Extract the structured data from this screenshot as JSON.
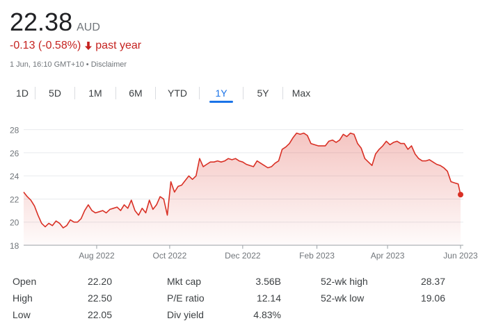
{
  "quote": {
    "price": "22.38",
    "currency": "AUD",
    "change": "-0.13 (-0.58%)",
    "period": "past year",
    "timestamp": "1 Jun, 16:10 GMT+10",
    "separator": "•",
    "disclaimer": "Disclaimer",
    "down_color": "#c5221f"
  },
  "tabs": [
    {
      "label": "1D",
      "active": false
    },
    {
      "label": "5D",
      "active": false
    },
    {
      "label": "1M",
      "active": false
    },
    {
      "label": "6M",
      "active": false
    },
    {
      "label": "YTD",
      "active": false
    },
    {
      "label": "1Y",
      "active": true
    },
    {
      "label": "5Y",
      "active": false
    },
    {
      "label": "Max",
      "active": false
    }
  ],
  "chart_data": {
    "type": "area",
    "title": "",
    "xlabel": "",
    "ylabel": "",
    "ylim": [
      18,
      29
    ],
    "yticks": [
      "18",
      "20",
      "22",
      "24",
      "26",
      "28"
    ],
    "xlim": [
      "2022-06-01",
      "2023-06-01"
    ],
    "xticks": [
      {
        "label": "Aug 2022",
        "date": "2022-08-01"
      },
      {
        "label": "Oct 2022",
        "date": "2022-10-01"
      },
      {
        "label": "Dec 2022",
        "date": "2022-12-01"
      },
      {
        "label": "Feb 2023",
        "date": "2023-02-01"
      },
      {
        "label": "Apr 2023",
        "date": "2023-04-01"
      },
      {
        "label": "Jun 2023",
        "date": "2023-06-01"
      }
    ],
    "line_color": "#d93025",
    "grid": true,
    "x": [
      "2022-06-01",
      "2022-06-04",
      "2022-06-07",
      "2022-06-10",
      "2022-06-13",
      "2022-06-16",
      "2022-06-19",
      "2022-06-22",
      "2022-06-25",
      "2022-06-28",
      "2022-07-01",
      "2022-07-04",
      "2022-07-07",
      "2022-07-10",
      "2022-07-13",
      "2022-07-16",
      "2022-07-19",
      "2022-07-22",
      "2022-07-25",
      "2022-07-28",
      "2022-07-31",
      "2022-08-03",
      "2022-08-06",
      "2022-08-09",
      "2022-08-12",
      "2022-08-15",
      "2022-08-18",
      "2022-08-21",
      "2022-08-24",
      "2022-08-27",
      "2022-08-30",
      "2022-09-02",
      "2022-09-05",
      "2022-09-08",
      "2022-09-11",
      "2022-09-14",
      "2022-09-17",
      "2022-09-20",
      "2022-09-23",
      "2022-09-26",
      "2022-09-29",
      "2022-10-02",
      "2022-10-05",
      "2022-10-08",
      "2022-10-11",
      "2022-10-14",
      "2022-10-17",
      "2022-10-20",
      "2022-10-23",
      "2022-10-26",
      "2022-10-29",
      "2022-11-01",
      "2022-11-04",
      "2022-11-07",
      "2022-11-10",
      "2022-11-13",
      "2022-11-16",
      "2022-11-19",
      "2022-11-22",
      "2022-11-25",
      "2022-11-28",
      "2022-12-01",
      "2022-12-04",
      "2022-12-07",
      "2022-12-10",
      "2022-12-13",
      "2022-12-16",
      "2022-12-19",
      "2022-12-22",
      "2022-12-25",
      "2022-12-28",
      "2022-12-31",
      "2023-01-03",
      "2023-01-06",
      "2023-01-09",
      "2023-01-12",
      "2023-01-15",
      "2023-01-18",
      "2023-01-21",
      "2023-01-24",
      "2023-01-27",
      "2023-01-30",
      "2023-02-02",
      "2023-02-05",
      "2023-02-08",
      "2023-02-11",
      "2023-02-14",
      "2023-02-17",
      "2023-02-20",
      "2023-02-23",
      "2023-02-26",
      "2023-03-01",
      "2023-03-04",
      "2023-03-07",
      "2023-03-10",
      "2023-03-13",
      "2023-03-16",
      "2023-03-19",
      "2023-03-22",
      "2023-03-25",
      "2023-03-28",
      "2023-03-31",
      "2023-04-03",
      "2023-04-06",
      "2023-04-09",
      "2023-04-12",
      "2023-04-15",
      "2023-04-18",
      "2023-04-21",
      "2023-04-24",
      "2023-04-27",
      "2023-04-30",
      "2023-05-03",
      "2023-05-06",
      "2023-05-09",
      "2023-05-12",
      "2023-05-15",
      "2023-05-18",
      "2023-05-21",
      "2023-05-24",
      "2023-05-27",
      "2023-05-30",
      "2023-06-01"
    ],
    "values": [
      22.6,
      22.2,
      21.9,
      21.4,
      20.6,
      19.9,
      19.6,
      19.9,
      19.7,
      20.1,
      19.9,
      19.5,
      19.7,
      20.2,
      20.0,
      20.0,
      20.3,
      21.0,
      21.5,
      21.0,
      20.8,
      20.9,
      21.0,
      20.8,
      21.1,
      21.2,
      21.3,
      21.0,
      21.5,
      21.2,
      21.9,
      21.0,
      20.6,
      21.2,
      20.8,
      21.9,
      21.1,
      21.5,
      22.2,
      22.0,
      20.6,
      23.5,
      22.6,
      23.1,
      23.2,
      23.6,
      24.0,
      23.7,
      24.0,
      25.5,
      24.8,
      25.0,
      25.2,
      25.2,
      25.3,
      25.2,
      25.3,
      25.5,
      25.4,
      25.5,
      25.3,
      25.2,
      25.0,
      24.9,
      24.8,
      25.3,
      25.1,
      24.9,
      24.7,
      24.8,
      25.1,
      25.3,
      26.3,
      26.5,
      26.8,
      27.3,
      27.7,
      27.6,
      27.7,
      27.5,
      26.8,
      26.7,
      26.6,
      26.6,
      26.6,
      27.0,
      27.1,
      26.9,
      27.1,
      27.6,
      27.4,
      27.7,
      27.6,
      26.8,
      26.4,
      25.5,
      25.2,
      24.9,
      25.9,
      26.3,
      26.6,
      27.0,
      26.7,
      26.9,
      27.0,
      26.8,
      26.8,
      26.3,
      26.6,
      25.9,
      25.5,
      25.3,
      25.3,
      25.4,
      25.2,
      25.0,
      24.9,
      24.7,
      24.4,
      23.5,
      23.4,
      23.3,
      22.38
    ]
  },
  "stats": [
    [
      {
        "label": "Open",
        "value": "22.20"
      },
      {
        "label": "Mkt cap",
        "value": "3.56B"
      },
      {
        "label": "52-wk high",
        "value": "28.37"
      }
    ],
    [
      {
        "label": "High",
        "value": "22.50"
      },
      {
        "label": "P/E ratio",
        "value": "12.14"
      },
      {
        "label": "52-wk low",
        "value": "19.06"
      }
    ],
    [
      {
        "label": "Low",
        "value": "22.05"
      },
      {
        "label": "Div yield",
        "value": "4.83%"
      },
      {
        "label": "",
        "value": ""
      }
    ]
  ]
}
